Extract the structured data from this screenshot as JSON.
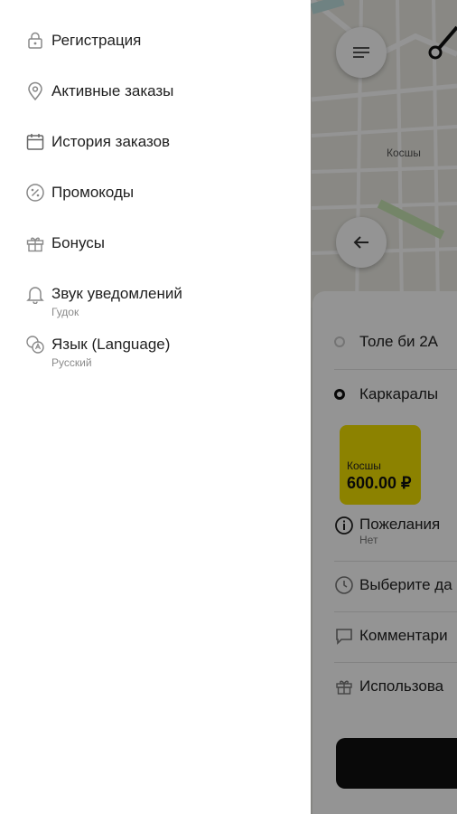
{
  "drawer": {
    "items": [
      {
        "label": "Регистрация",
        "icon": "lock-icon"
      },
      {
        "label": "Активные заказы",
        "icon": "location-pin-icon"
      },
      {
        "label": "История заказов",
        "icon": "calendar-icon"
      },
      {
        "label": "Промокоды",
        "icon": "percent-icon"
      },
      {
        "label": "Бонусы",
        "icon": "gift-icon"
      },
      {
        "label": "Звук уведомлений",
        "sub": "Гудок",
        "icon": "bell-icon"
      },
      {
        "label": "Язык (Language)",
        "sub": "Русский",
        "icon": "language-icon"
      }
    ]
  },
  "map": {
    "place_label": "Косшы"
  },
  "order": {
    "from": "Толе би 2А",
    "to": "Каркаралы",
    "tariff": {
      "name": "Косшы",
      "price": "600.00 ₽",
      "color": "#f2e100"
    },
    "wishes": {
      "label": "Пожелания",
      "value": "Нет"
    },
    "datetime_label": "Выберите да",
    "comment_label": "Комментари",
    "bonus_label": "Использова"
  },
  "colors": {
    "accent": "#f2e100",
    "button": "#111111"
  }
}
